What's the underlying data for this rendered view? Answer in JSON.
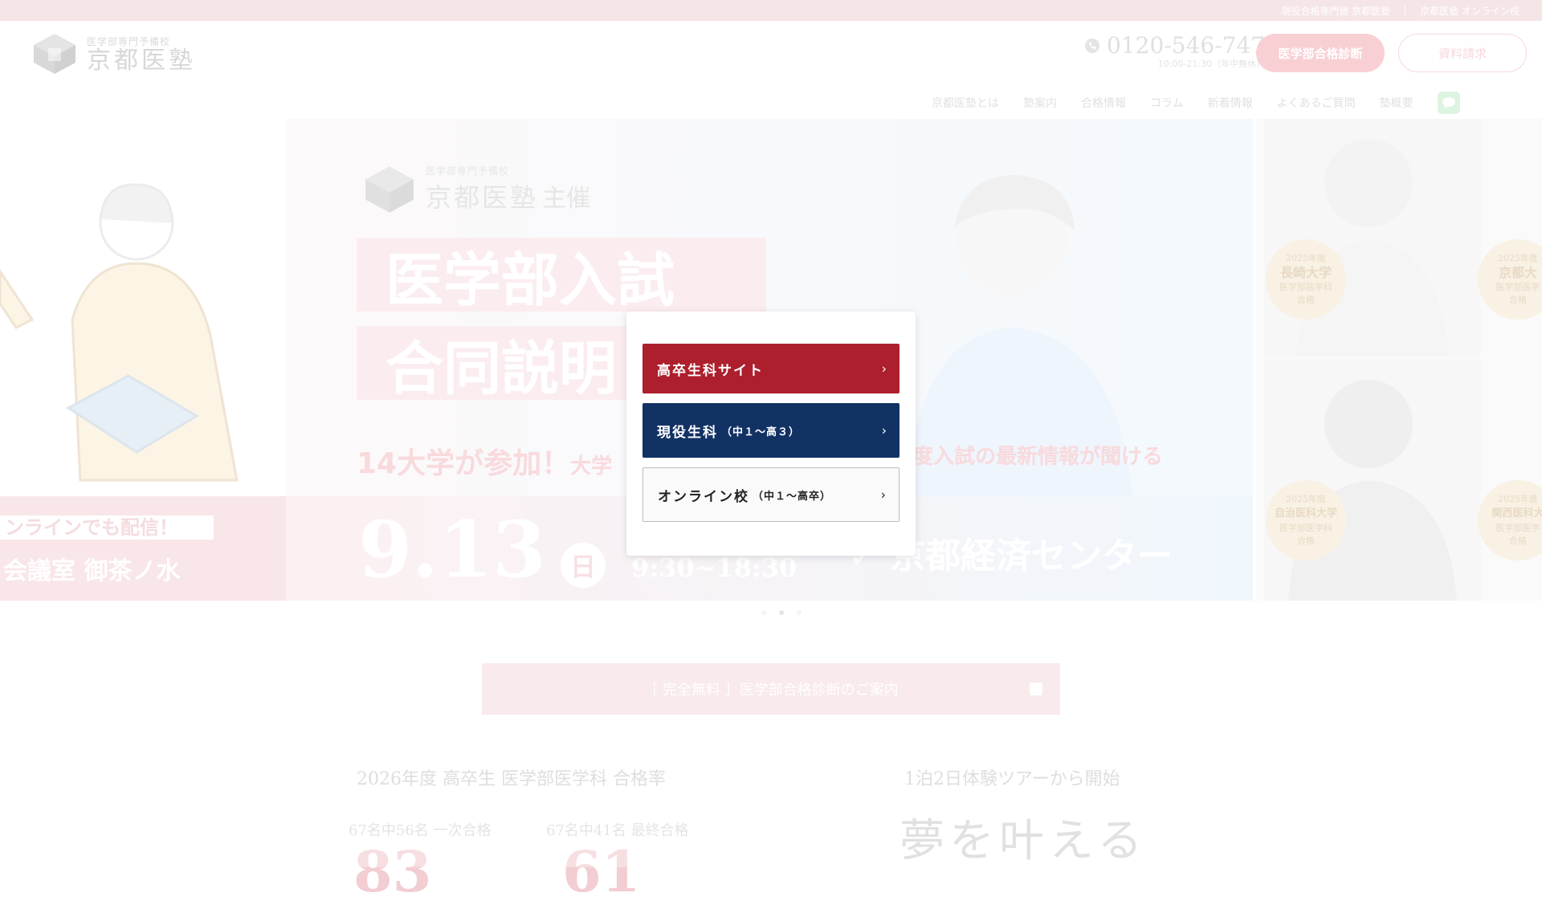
{
  "topbar": {
    "link1": "現役合格専門塾 京都医塾",
    "link2": "京都医塾 オンライン校"
  },
  "header": {
    "logo_small": "医学部専門予備校",
    "logo_big": "京都医塾",
    "phone": "0120-546-747",
    "phone_hours": "10:00-21:30（年中無休）",
    "btn_diagnosis": "医学部合格診断",
    "btn_request": "資料請求",
    "nav": [
      "京都医塾とは",
      "塾案内",
      "合格情報",
      "コラム",
      "新着情報",
      "よくあるご質問",
      "塾概要"
    ],
    "line_icon": "line-icon"
  },
  "hero": {
    "left_tag1": "ンラインでも配信！",
    "left_tag2": "会議室 御茶ノ水",
    "sub_logo_small": "医学部専門予備校",
    "sub_logo_big": "京都医塾",
    "sub_logo_suffix": "主催",
    "title_line1": "医学部入試",
    "title_line2": "合同説明",
    "banner_main": "14大学が参加！",
    "banner_rest": "大学",
    "banner_right": "度入試の最新情報が聞ける",
    "date": "9.13",
    "day": "日",
    "time": "9:30~18:30",
    "venue": "京都経済センター",
    "medals": [
      {
        "year": "2025年度",
        "uni": "長崎大学",
        "dept": "医学部医学科",
        "result": "合格"
      },
      {
        "year": "2025年度",
        "uni": "京都大",
        "dept": "医学部医学",
        "result": "合格"
      },
      {
        "year": "2025年度",
        "uni": "自治医科大学",
        "dept": "医学部医学科",
        "result": "合格"
      },
      {
        "year": "2025年度",
        "uni": "関西医科大",
        "dept": "医学部医学",
        "result": "合格"
      }
    ]
  },
  "free_banner": "［ 完全無料 ］医学部合格診断のご案内",
  "stats": {
    "title": "2026年度 高卒生 医学部医学科 合格率",
    "sub1": "67名中56名 一次合格",
    "sub2": "67名中41名 最終合格",
    "num1": "83",
    "num2": "61"
  },
  "tour": {
    "title": "1泊2日体験ツアーから開始",
    "big": "夢を叶える"
  },
  "modal": {
    "choice1": "高卒生科サイト",
    "choice2_main": "現役生科",
    "choice2_small": "（中１〜高３）",
    "choice3_main": "オンライン校",
    "choice3_small": "（中１〜高卒）",
    "chevron": "›"
  },
  "colors": {
    "red": "#ad1f2d",
    "navy": "#123264",
    "pink_light": "#f6dfe1"
  }
}
